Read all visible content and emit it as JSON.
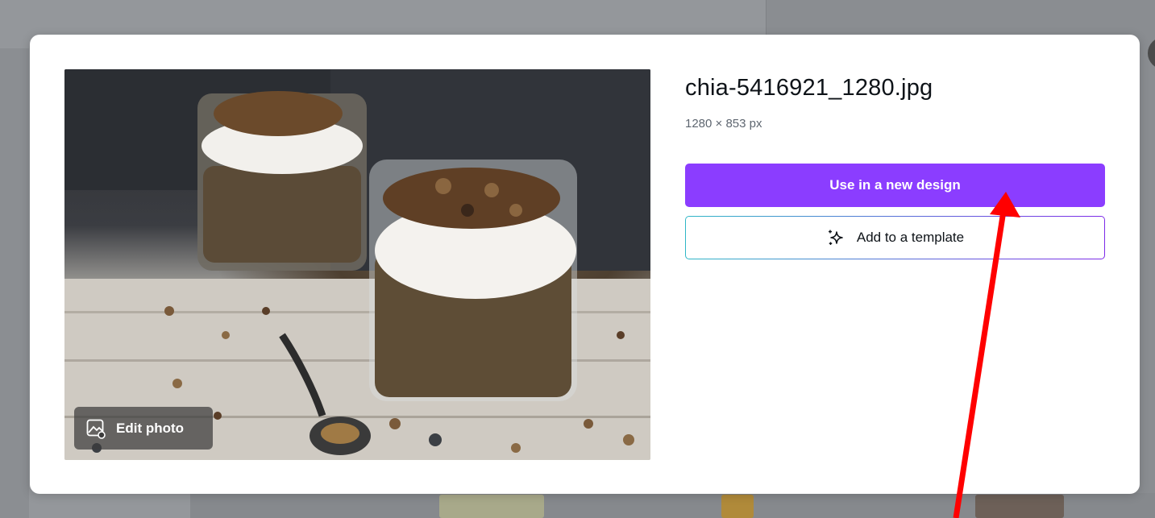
{
  "file": {
    "name": "chia-5416921_1280.jpg",
    "dimensions": "1280 × 853 px"
  },
  "actions": {
    "use_new_design": "Use in a new design",
    "add_to_template": "Add to a template",
    "edit_photo": "Edit photo"
  },
  "icons": {
    "edit_photo": "image-edit-icon",
    "add_to_template": "sparkle-icon",
    "close": "close-icon"
  },
  "colors": {
    "primary": "#8b3dff",
    "annotation": "#ff0000",
    "overlay": "#94979b"
  }
}
